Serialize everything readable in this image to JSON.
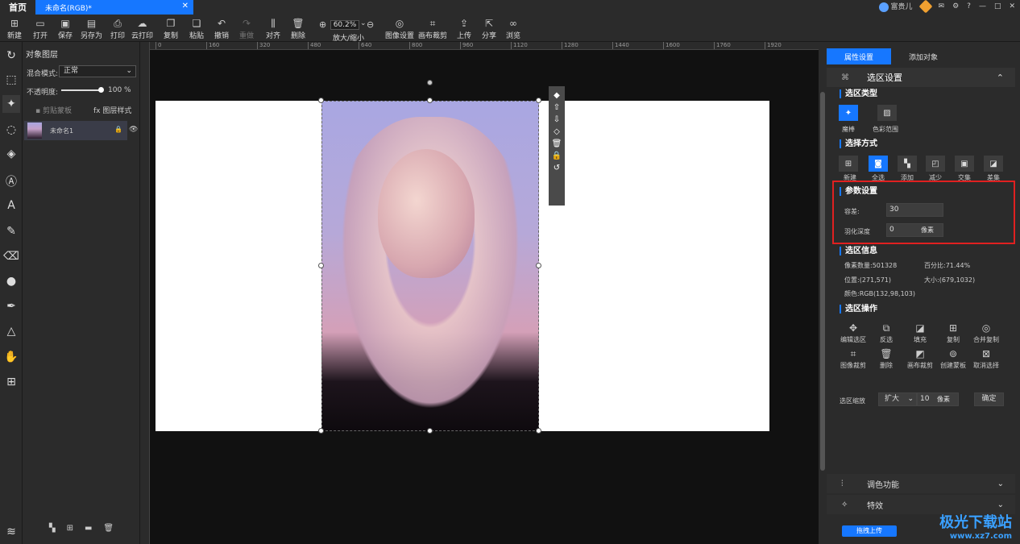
{
  "titlebar": {
    "home": "首页",
    "doc_tab": "未命名(RGB)*",
    "user": "富贵儿"
  },
  "toolbar": {
    "items": [
      "新建",
      "打开",
      "保存",
      "另存为",
      "打印",
      "云打印",
      "复制",
      "粘贴",
      "撤销",
      "重做",
      "对齐",
      "删除"
    ],
    "zoom_value": "60.2%",
    "zoom_label": "放大/缩小",
    "image_settings": "图像设置",
    "canvas_crop": "画布裁剪",
    "upload": "上传",
    "share": "分享",
    "browse": "浏览"
  },
  "layers_panel": {
    "title": "对象图层",
    "blend_label": "混合模式:",
    "blend_value": "正常",
    "opacity_label": "不透明度:",
    "opacity_value": "100 %",
    "opacity_level": 1.0,
    "clip_mask": "剪贴蒙板",
    "layer_style": "图层样式",
    "layer_name": "未命名1"
  },
  "ruler_ticks": [
    "0",
    "160",
    "320",
    "480",
    "640",
    "800",
    "960",
    "1120",
    "1280",
    "1440",
    "1600",
    "1760",
    "1920"
  ],
  "right_panel": {
    "tab_properties": "属性设置",
    "tab_add": "添加对象",
    "header": "选区设置",
    "sel_type_title": "选区类型",
    "sel_types": [
      "魔棒",
      "色彩范围"
    ],
    "sel_mode_title": "选择方式",
    "sel_modes": [
      "新建",
      "全选",
      "添加",
      "减少",
      "交集",
      "差集"
    ],
    "param_title": "参数设置",
    "tolerance_label": "容差:",
    "tolerance_value": "30",
    "feather_label": "羽化深度",
    "feather_value": "0",
    "feather_unit": "像素",
    "info_title": "选区信息",
    "pixel_count": "像素数量:501328",
    "percent": "百分比:71.44%",
    "position": "位置:(271,571)",
    "size": "大小:(679,1032)",
    "color": "颜色:RGB(132,98,103)",
    "ops_title": "选区操作",
    "ops_row1": [
      "编辑选区",
      "反选",
      "填充",
      "复制",
      "合并复制"
    ],
    "ops_row2": [
      "图像裁剪",
      "删除",
      "画布裁剪",
      "创建蒙板",
      "取消选择"
    ],
    "zoom_label": "选区缩放",
    "zoom_mode": "扩大",
    "zoom_value": "10",
    "zoom_unit": "像素",
    "confirm": "确定",
    "fold_color": "调色功能",
    "fold_effects": "特效"
  },
  "upload_chip": "拖拽上传",
  "watermark": {
    "text": "极光下载站",
    "url": "www.xz7.com"
  }
}
